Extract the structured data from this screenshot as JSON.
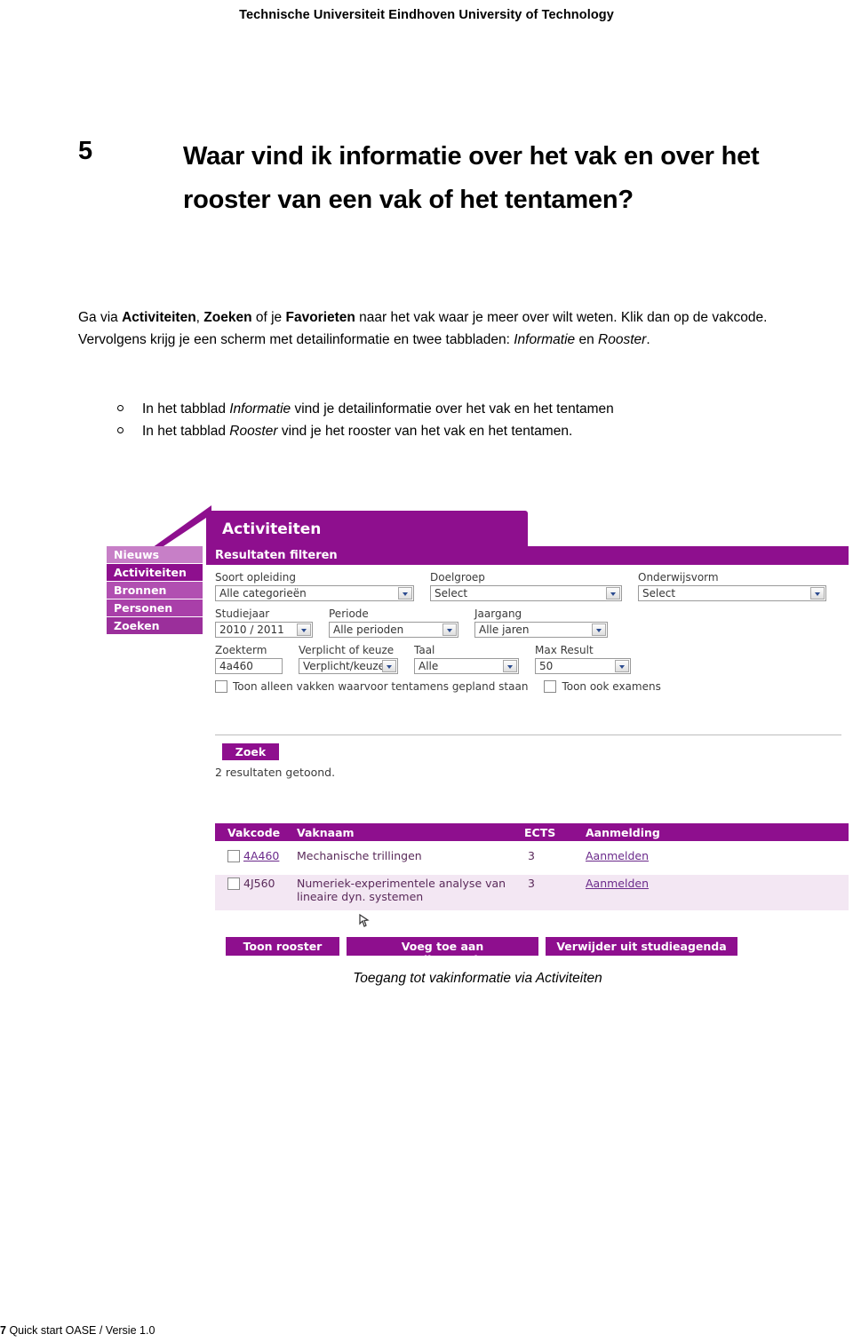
{
  "header": {
    "title": "Technische Universiteit Eindhoven University of Technology"
  },
  "heading": {
    "number": "5",
    "text": "Waar vind ik informatie over het vak en over het rooster van een vak of het tentamen?"
  },
  "paragraph": {
    "part1": "Ga via ",
    "bold1": "Activiteiten",
    "part2": ", ",
    "bold2": "Zoeken",
    "part3": " of je ",
    "bold3": "Favorieten",
    "part4": " naar het vak waar je meer over wilt weten. ",
    "part5": "Klik dan op de vakcode. Vervolgens krijg je een scherm met detailinformatie en twee tabbladen: ",
    "italic1": "Informatie",
    "part6": " en ",
    "italic2": "Rooster",
    "part7": "."
  },
  "bullets": [
    {
      "pre": "In het tabblad ",
      "italic": "Informatie",
      "post": " vind je detailinformatie over het vak en het tentamen"
    },
    {
      "pre": "In het tabblad ",
      "italic": "Rooster",
      "post": " vind je het rooster van het vak en het tentamen."
    }
  ],
  "screenshot": {
    "tab_label": "Activiteiten",
    "nav": [
      {
        "label": "Nieuws"
      },
      {
        "label": "Activiteiten"
      },
      {
        "label": "Bronnen"
      },
      {
        "label": "Personen"
      },
      {
        "label": "Zoeken"
      }
    ],
    "filter_panel_title": "Resultaten filteren",
    "fields": [
      {
        "label": "Soort opleiding",
        "value": "Alle categorieën",
        "type": "select"
      },
      {
        "label": "Doelgroep",
        "value": "Select",
        "type": "select"
      },
      {
        "label": "Onderwijsvorm",
        "value": "Select",
        "type": "select"
      },
      {
        "label": "Studiejaar",
        "value": "2010 / 2011",
        "type": "select"
      },
      {
        "label": "Periode",
        "value": "Alle perioden",
        "type": "select"
      },
      {
        "label": "Jaargang",
        "value": "Alle jaren",
        "type": "select"
      },
      {
        "label": "Zoekterm",
        "value": "4a460",
        "type": "text"
      },
      {
        "label": "Verplicht of keuze",
        "value": "Verplicht/keuze",
        "type": "select"
      },
      {
        "label": "Taal",
        "value": "Alle",
        "type": "select"
      },
      {
        "label": "Max Result",
        "value": "50",
        "type": "select"
      }
    ],
    "checkboxes": [
      {
        "label": "Toon alleen vakken waarvoor tentamens gepland staan",
        "checked": false
      },
      {
        "label": "Toon ook examens",
        "checked": false
      }
    ],
    "search_button": "Zoek",
    "results_text": "2 resultaten getoond.",
    "table": {
      "columns": [
        "Vakcode",
        "Vaknaam",
        "ECTS",
        "Aanmelding"
      ],
      "rows": [
        {
          "vakcode": "4A460",
          "vaknaam": "Mechanische trillingen",
          "ects": "3",
          "aanmelding": "Aanmelden"
        },
        {
          "vakcode": "4J560",
          "vaknaam": "Numeriek-experimentele analyse van lineaire dyn. systemen",
          "ects": "3",
          "aanmelding": "Aanmelden"
        }
      ]
    },
    "buttons": [
      {
        "label": "Toon rooster"
      },
      {
        "label": "Voeg toe aan studieagenda"
      },
      {
        "label": "Verwijder uit studieagenda"
      }
    ],
    "caption": "Toegang tot vakinformatie via Activiteiten"
  },
  "footer": {
    "page": "7",
    "text": "Quick start OASE / Versie 1.0"
  }
}
